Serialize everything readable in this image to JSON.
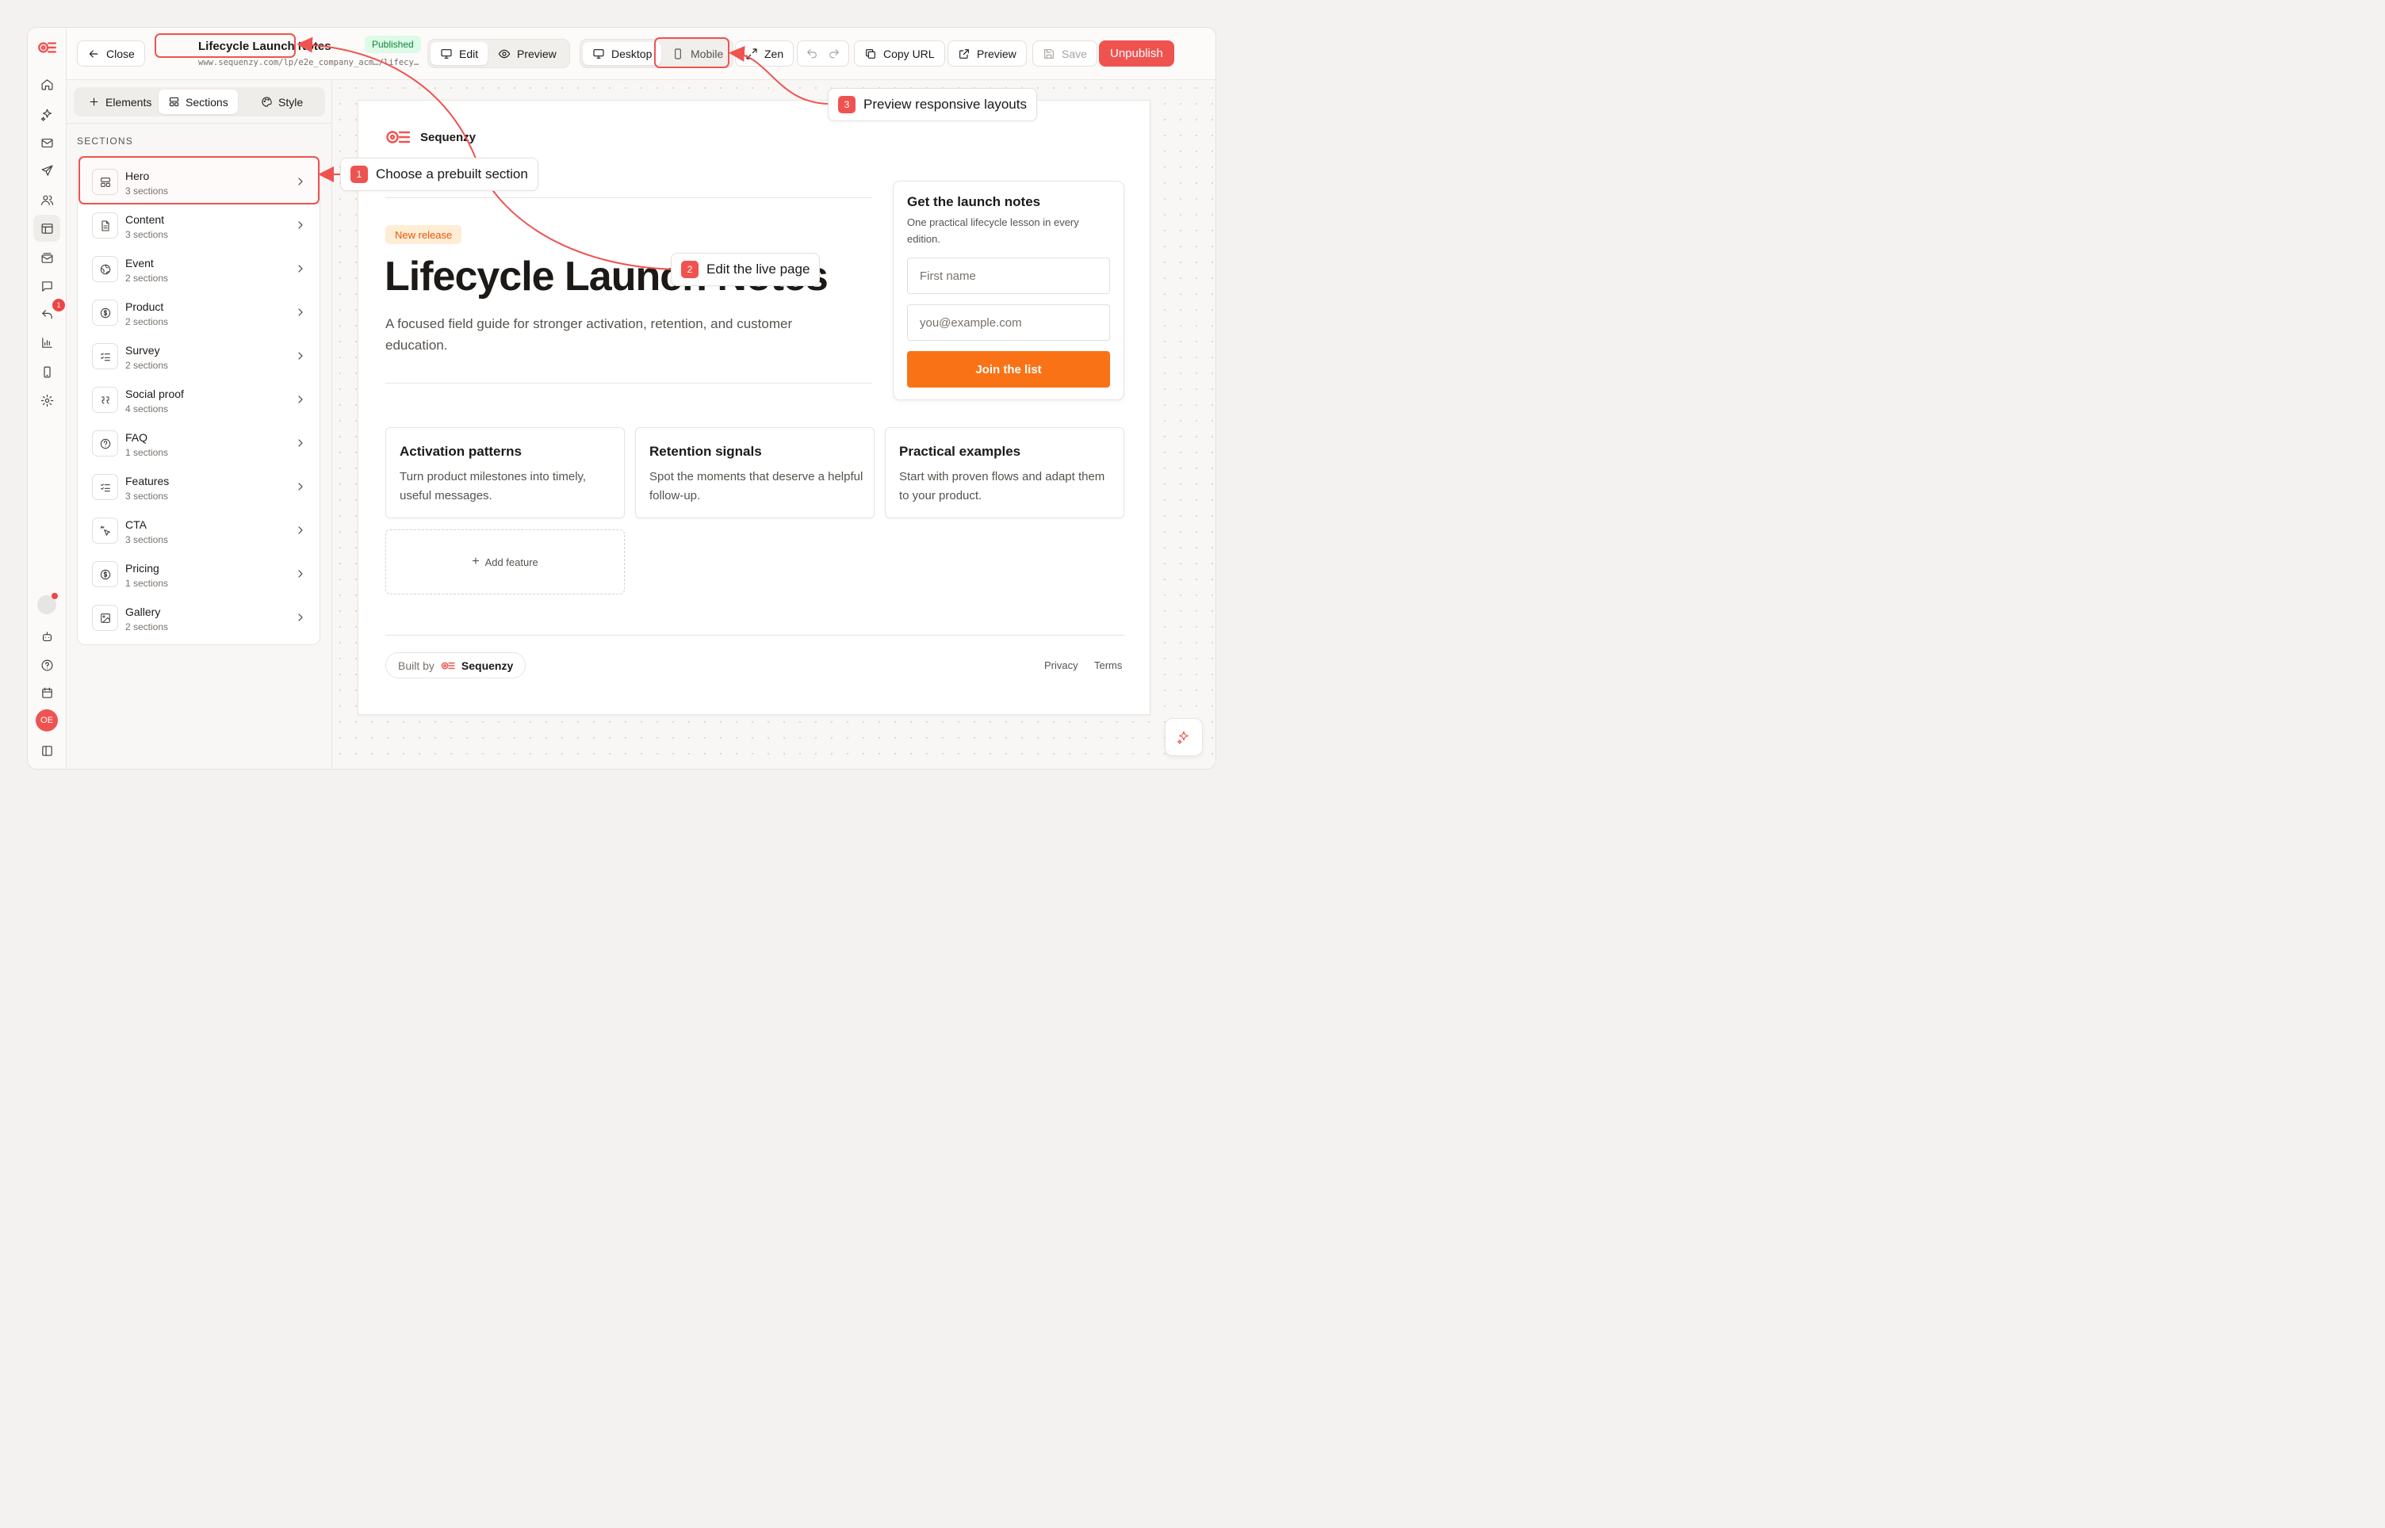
{
  "topbar": {
    "close_label": "Close",
    "page_title": "Lifecycle Launch Notes",
    "page_url": "www.sequenzy.com/lp/e2e_company_acm…/lifecy…",
    "status_badge": "Published",
    "mode_tabs": [
      {
        "label": "Edit",
        "icon": "monitor-icon",
        "active": true
      },
      {
        "label": "Preview",
        "icon": "eye-icon",
        "active": false
      }
    ],
    "device_tabs": [
      {
        "label": "Desktop",
        "icon": "desktop-icon",
        "active": true
      },
      {
        "label": "Mobile",
        "icon": "mobile-icon",
        "active": false
      }
    ],
    "zen_label": "Zen",
    "copy_url_label": "Copy URL",
    "preview_label": "Preview",
    "save_label": "Save",
    "unpublish_label": "Unpublish"
  },
  "rail": {
    "items": [
      "home-icon",
      "sparkles-icon",
      "mail-icon",
      "send-icon",
      "users-icon",
      "layout-icon",
      "mail-stack-icon",
      "chat-icon",
      "reply-icon",
      "chart-icon",
      "mobile-icon",
      "gear-icon"
    ],
    "active": "layout-icon",
    "reply_badge": "1",
    "avatar_initials": "OE"
  },
  "panel": {
    "tabs": [
      {
        "label": "Elements",
        "icon": "plus-icon",
        "active": false
      },
      {
        "label": "Sections",
        "icon": "layout-icon",
        "active": true
      },
      {
        "label": "Style",
        "icon": "palette-icon",
        "active": false
      }
    ],
    "heading": "SECTIONS",
    "sections": [
      {
        "name": "Hero",
        "count": "3 sections",
        "icon": "hero-icon"
      },
      {
        "name": "Content",
        "count": "3 sections",
        "icon": "document-icon"
      },
      {
        "name": "Event",
        "count": "2 sections",
        "icon": "globe-icon"
      },
      {
        "name": "Product",
        "count": "2 sections",
        "icon": "dollar-icon"
      },
      {
        "name": "Survey",
        "count": "2 sections",
        "icon": "checklist-icon"
      },
      {
        "name": "Social proof",
        "count": "4 sections",
        "icon": "quote-icon"
      },
      {
        "name": "FAQ",
        "count": "1 sections",
        "icon": "question-icon"
      },
      {
        "name": "Features",
        "count": "3 sections",
        "icon": "checklist-icon"
      },
      {
        "name": "CTA",
        "count": "3 sections",
        "icon": "pointer-icon"
      },
      {
        "name": "Pricing",
        "count": "1 sections",
        "icon": "dollar-icon"
      },
      {
        "name": "Gallery",
        "count": "2 sections",
        "icon": "image-icon"
      }
    ]
  },
  "landing": {
    "brand": "Sequenzy",
    "badge": "New release",
    "title": "Lifecycle Launch Notes",
    "subtitle": "A focused field guide for stronger activation, retention, and customer education.",
    "signup": {
      "title": "Get the launch notes",
      "description": "One practical lifecycle lesson in every edition.",
      "first_name_placeholder": "First name",
      "email_placeholder": "you@example.com",
      "button_label": "Join the list"
    },
    "features": [
      {
        "title": "Activation patterns",
        "desc": "Turn product milestones into timely, useful messages."
      },
      {
        "title": "Retention signals",
        "desc": "Spot the moments that deserve a helpful follow-up."
      },
      {
        "title": "Practical examples",
        "desc": "Start with proven flows and adapt them to your product."
      }
    ],
    "add_feature_label": "Add feature",
    "built_by_prefix": "Built by",
    "built_by_brand": "Sequenzy",
    "footer_links": [
      "Privacy",
      "Terms"
    ]
  },
  "annotations": [
    {
      "number": "1",
      "text": "Choose a prebuilt section"
    },
    {
      "number": "2",
      "text": "Edit the live page"
    },
    {
      "number": "3",
      "text": "Preview responsive layouts"
    }
  ],
  "colors": {
    "accent": "#ef5350",
    "cta_orange": "#f97316",
    "published_green": "#15803d",
    "badge_orange": "#ea580c"
  }
}
